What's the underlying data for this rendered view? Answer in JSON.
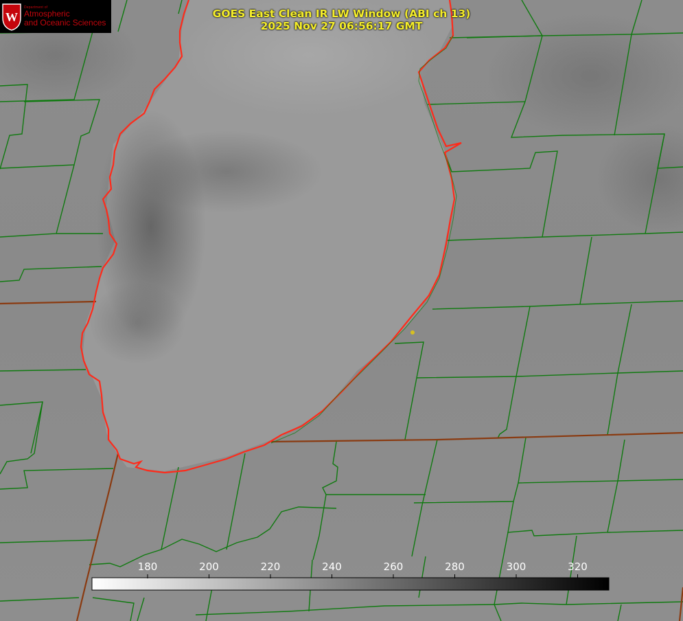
{
  "logo": {
    "department": "Department of",
    "line1": "Atmospheric",
    "line2": "and Oceanic Sciences",
    "shield_letter": "W",
    "colors": {
      "background": "#000000",
      "text": "#c5050c",
      "shield": "#c5050c"
    }
  },
  "title": {
    "line1": "GOES East Clean IR LW Window (ABI ch 13)",
    "line2": "2025 Nov 27 06:56:17 GMT",
    "color": "#f5ee2a"
  },
  "colorbar": {
    "ticks": [
      "180",
      "200",
      "220",
      "240",
      "260",
      "280",
      "300",
      "320"
    ],
    "gradient_from": "#ffffff",
    "gradient_to": "#000000"
  },
  "map": {
    "boundary_color": "#0f7a0f",
    "state_boundary_color": "#8a3a10",
    "lakeshore_color": "#ff2a1a",
    "marker_color": "#d8c020"
  }
}
